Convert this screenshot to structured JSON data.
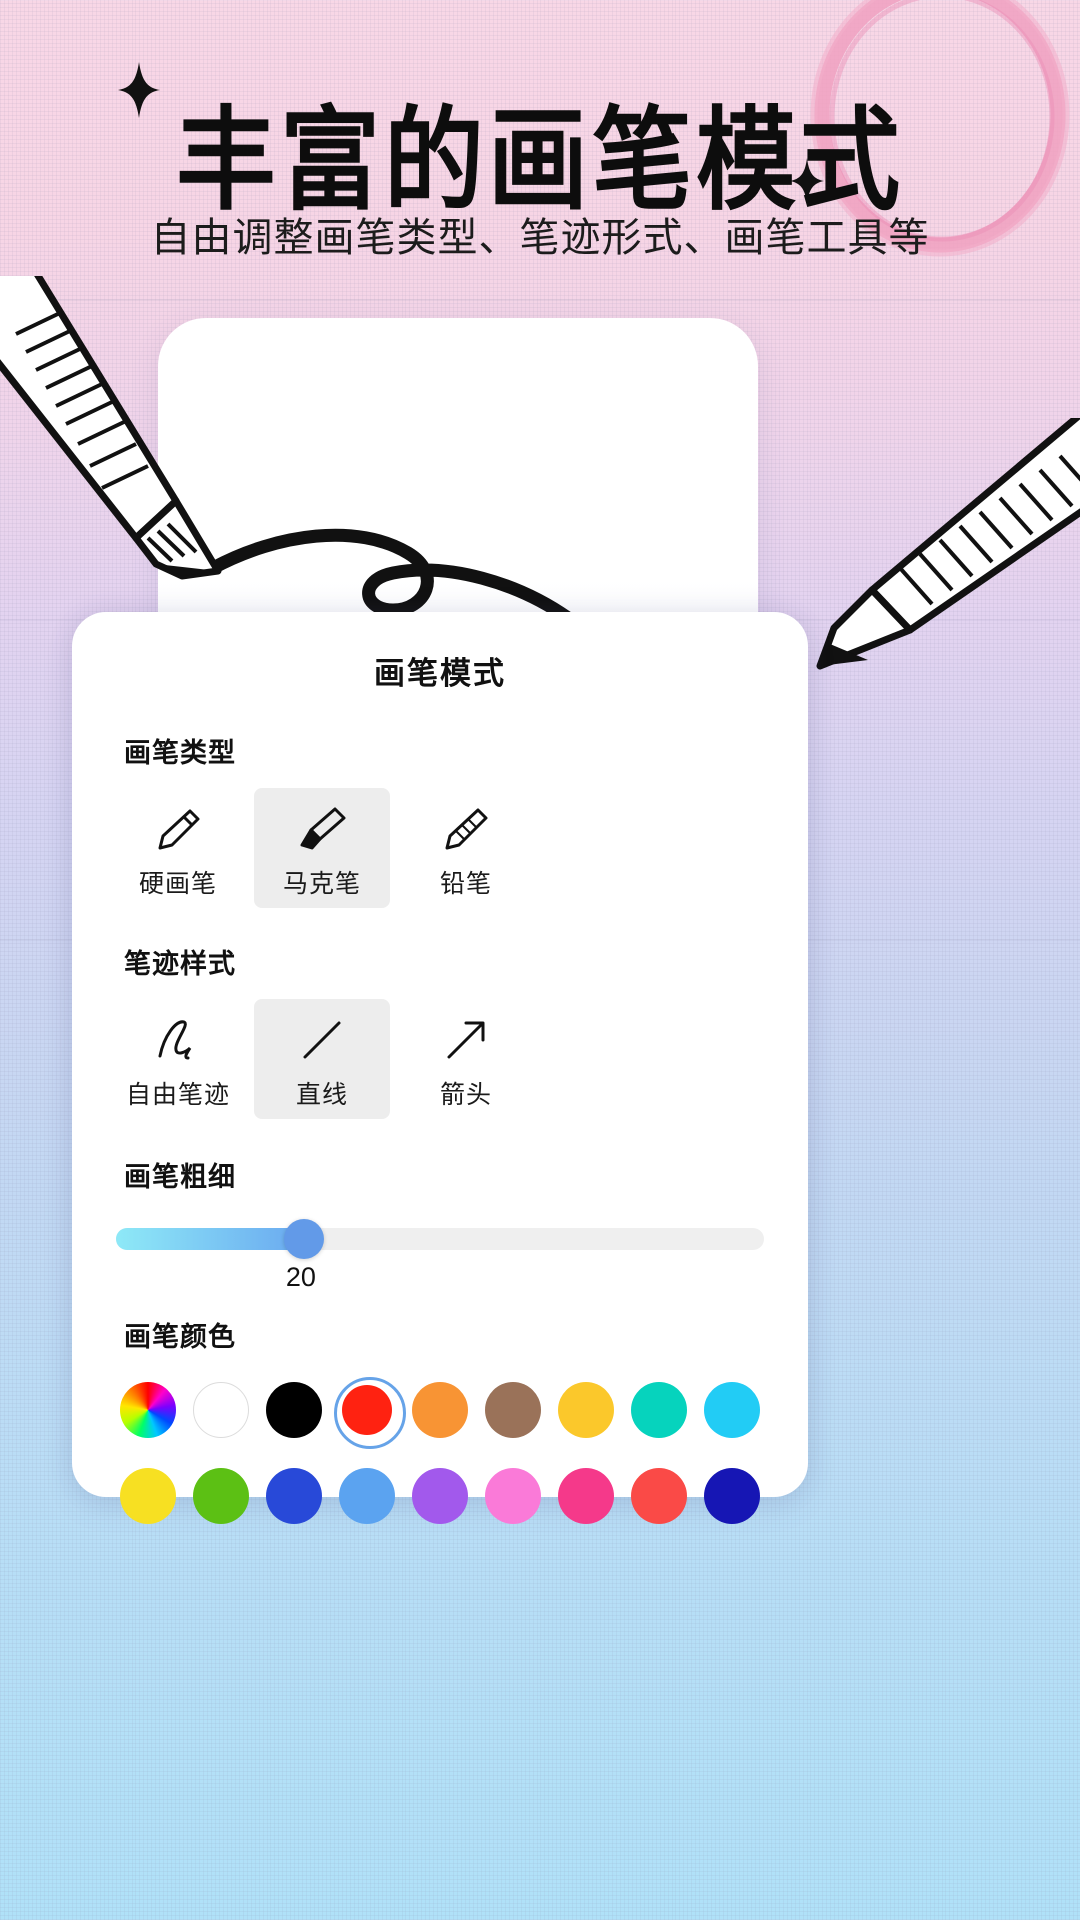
{
  "header": {
    "title": "丰富的画笔模式",
    "subtitle": "自由调整画笔类型、笔迹形式、画笔工具等"
  },
  "panel": {
    "title": "画笔模式",
    "brush_type": {
      "label": "画笔类型",
      "options": [
        {
          "label": "硬画笔",
          "icon": "pen-icon",
          "selected": false
        },
        {
          "label": "马克笔",
          "icon": "marker-icon",
          "selected": true
        },
        {
          "label": "铅笔",
          "icon": "pencil-icon",
          "selected": false
        }
      ]
    },
    "stroke_style": {
      "label": "笔迹样式",
      "options": [
        {
          "label": "自由笔迹",
          "icon": "freehand-icon",
          "selected": false
        },
        {
          "label": "直线",
          "icon": "line-icon",
          "selected": true
        },
        {
          "label": "箭头",
          "icon": "arrow-icon",
          "selected": false
        }
      ]
    },
    "thickness": {
      "label": "画笔粗细",
      "value": "20",
      "percent": 29,
      "track_color": "#efefef",
      "fill_start": "#8ee9f7",
      "fill_end": "#6aa9f0",
      "thumb_color": "#629ae8"
    },
    "color": {
      "label": "画笔颜色",
      "selected_color": "#FF2211",
      "selection_ring": "#66a3e8",
      "rows": [
        [
          {
            "name": "color-wheel",
            "hex": "wheel",
            "selected": false
          },
          {
            "name": "white",
            "hex": "#FFFFFF",
            "selected": false
          },
          {
            "name": "black",
            "hex": "#000000",
            "selected": false
          },
          {
            "name": "red",
            "hex": "#FF2211",
            "selected": true
          },
          {
            "name": "orange",
            "hex": "#F89434",
            "selected": false
          },
          {
            "name": "brown",
            "hex": "#9A7259",
            "selected": false
          },
          {
            "name": "yellow",
            "hex": "#FBC82B",
            "selected": false
          },
          {
            "name": "teal",
            "hex": "#06D3BD",
            "selected": false
          },
          {
            "name": "cyan",
            "hex": "#22CCF5",
            "selected": false
          }
        ],
        [
          {
            "name": "bright-yellow",
            "hex": "#F7E022",
            "selected": false
          },
          {
            "name": "green",
            "hex": "#5CC014",
            "selected": false
          },
          {
            "name": "blue",
            "hex": "#2849D8",
            "selected": false
          },
          {
            "name": "light-blue",
            "hex": "#5BA3F0",
            "selected": false
          },
          {
            "name": "purple",
            "hex": "#A259EC",
            "selected": false
          },
          {
            "name": "pink",
            "hex": "#FA7AD8",
            "selected": false
          },
          {
            "name": "magenta",
            "hex": "#F5398A",
            "selected": false
          },
          {
            "name": "coral-red",
            "hex": "#FA4A47",
            "selected": false
          },
          {
            "name": "navy",
            "hex": "#1616B4",
            "selected": false
          }
        ]
      ]
    }
  }
}
